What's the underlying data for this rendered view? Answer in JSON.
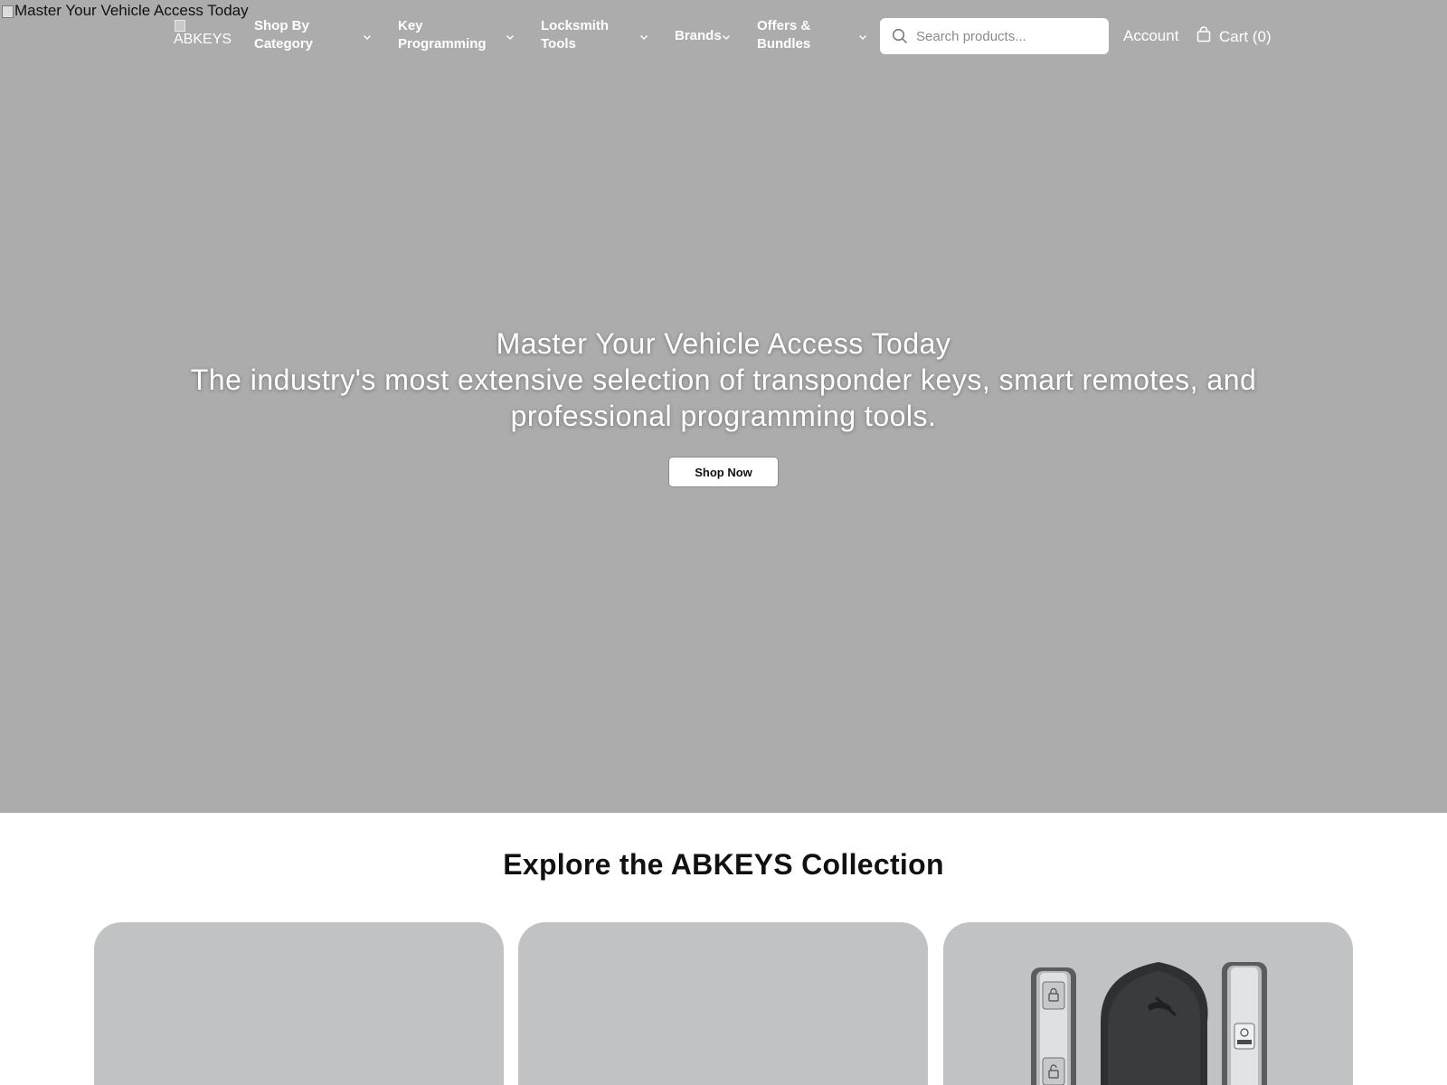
{
  "broken_image_alt": "Master Your Vehicle Access Today",
  "header": {
    "logo_alt": "ABKEYS",
    "nav": [
      {
        "label_line1": "Shop By",
        "label_line2": "Category"
      },
      {
        "label_line1": "Key",
        "label_line2": "Programming"
      },
      {
        "label_line1": "Locksmith",
        "label_line2": "Tools"
      },
      {
        "label_line1": "Brands",
        "label_line2": ""
      },
      {
        "label_line1": "Offers &",
        "label_line2": "Bundles"
      }
    ],
    "search_placeholder": "Search products...",
    "account_label": "Account",
    "cart_label": "Cart (0)"
  },
  "hero": {
    "title": "Master Your Vehicle Access Today",
    "subtitle_line1": "The industry's most extensive selection of transponder keys, smart remotes, and",
    "subtitle_line2": "professional programming tools.",
    "cta_label": "Shop Now"
  },
  "collection": {
    "title": "Explore the ABKEYS Collection",
    "icons": [
      "search-icon",
      "bag-icon",
      "chevron-down-icon",
      "lock-icon",
      "unlock-icon"
    ]
  },
  "colors": {
    "hero_bg": "#acacac",
    "card_bg": "#c1c2c4",
    "text_dark": "#111111"
  }
}
